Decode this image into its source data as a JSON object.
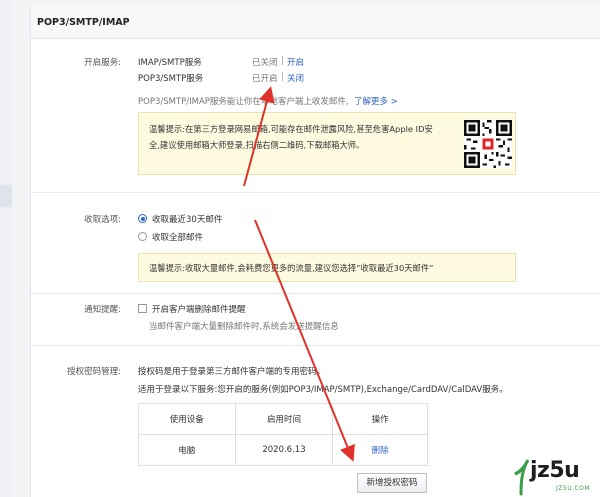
{
  "panel": {
    "title": "POP3/SMTP/IMAP"
  },
  "service": {
    "label": "开启服务:",
    "rows": [
      {
        "name": "IMAP/SMTP服务",
        "status": "已关闭",
        "sep": "|",
        "action": "开启"
      },
      {
        "name": "POP3/SMTP服务",
        "status": "已开启",
        "sep": "|",
        "action": "关闭"
      }
    ],
    "desc": "POP3/SMTP/IMAP服务能让你在本地客户端上收发邮件,",
    "learn_more": "了解更多 >",
    "tip_line1": "温馨提示:在第三方登录网易邮箱,可能存在邮件泄露风险,甚至危害Apple ID安",
    "tip_line2": "全,建议使用邮箱大师登录,扫描右侧二维码,下载邮箱大师。",
    "qr_icon": "qr-code-icon"
  },
  "receive": {
    "label": "收取选项:",
    "option_recent": "收取最近30天邮件",
    "option_all": "收取全部邮件",
    "selected": "recent",
    "tip": "温馨提示:收取大量邮件,会耗费您更多的流量,建议您选择“收取最近30天邮件”"
  },
  "notify": {
    "label": "通知提醒:",
    "checkbox_label": "开启客户端删除邮件提醒",
    "checked": false,
    "desc": "当邮件客户端大量删除邮件时,系统会发送提醒信息"
  },
  "auth": {
    "label": "授权密码管理:",
    "line1": "授权码是用于登录第三方邮件客户端的专用密码。",
    "line2": "适用于登录以下服务:您开启的服务(例如POP3/IMAP/SMTP),Exchange/CardDAV/CalDAV服务。",
    "table": {
      "headers": [
        "使用设备",
        "启用时间",
        "操作"
      ],
      "rows": [
        {
          "device": "电脑",
          "time": "2020.6.13",
          "action": "删除"
        }
      ]
    },
    "new_button": "新增授权密码"
  },
  "watermark": {
    "logo": "jz5u",
    "sub": "JZ5U.COM"
  },
  "colors": {
    "link": "#2f64c8",
    "tip_bg": "#fffbe0",
    "arrow": "#e0322a"
  }
}
